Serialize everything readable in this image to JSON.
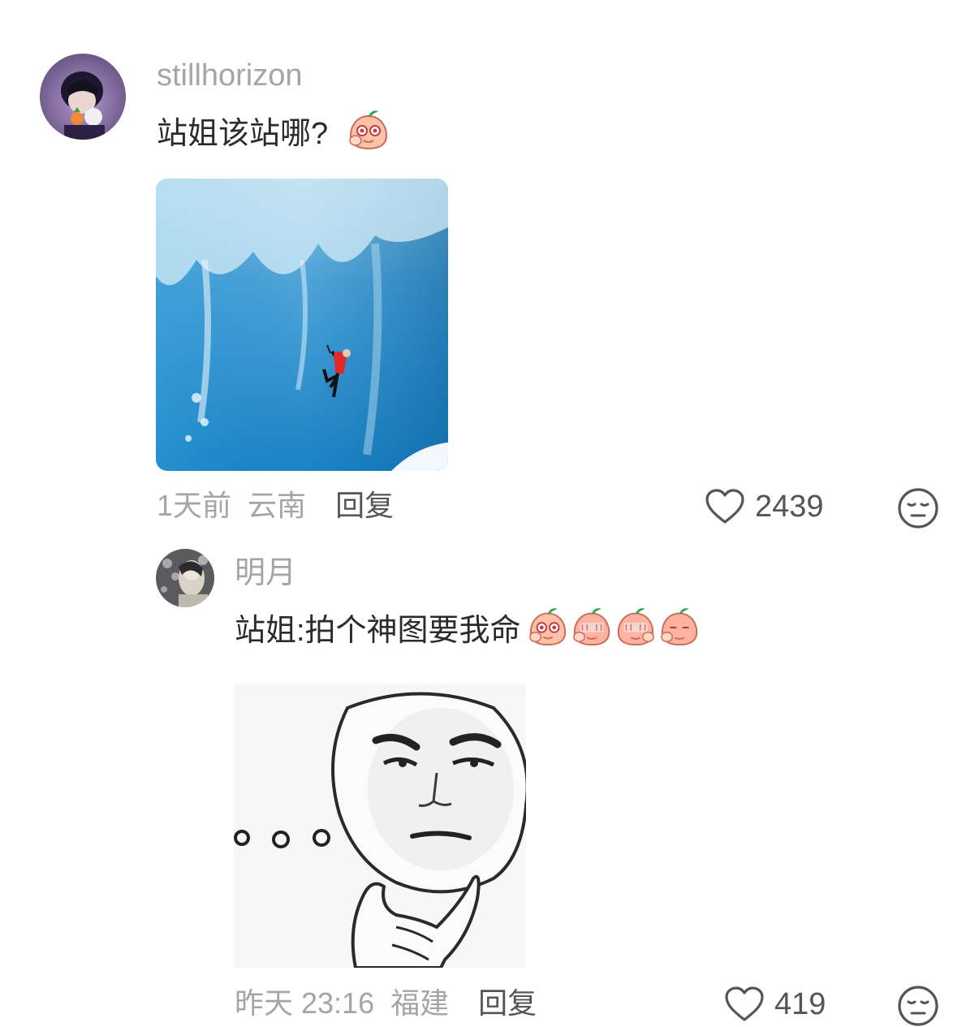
{
  "comments": [
    {
      "username": "stillhorizon",
      "text": "站姐该站哪?",
      "emojis": [
        "peach-face-emoji"
      ],
      "image": "ice-climber-photo",
      "time": "1天前",
      "location": "云南",
      "reply_label": "回复",
      "likes": "2439"
    },
    {
      "username": "明月",
      "text": "站姐:拍个神图要我命",
      "emojis": [
        "peach-face-emoji",
        "peach-face-emoji",
        "peach-face-emoji",
        "peach-face-emoji"
      ],
      "image": "thinking-meme",
      "time": "昨天 23:16",
      "location": "福建",
      "reply_label": "回复",
      "likes": "419"
    }
  ],
  "colors": {
    "muted_text": "#a5a5a5",
    "body_text": "#2b2b2b",
    "icon": "#555555"
  },
  "icons": [
    "heart-icon",
    "neutral-face-icon"
  ]
}
